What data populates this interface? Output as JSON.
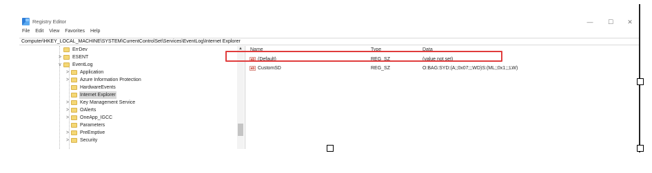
{
  "window": {
    "title": "Registry Editor",
    "controls": {
      "minimize": "—",
      "maximize": "☐",
      "close": "✕"
    }
  },
  "menu": [
    "File",
    "Edit",
    "View",
    "Favorites",
    "Help"
  ],
  "address": "Computer\\HKEY_LOCAL_MACHINE\\SYSTEM\\CurrentControlSet\\Services\\EventLog\\Internet Explorer",
  "tree": [
    {
      "label": "ErrDev",
      "expander": ""
    },
    {
      "label": "ESENT",
      "expander": ">"
    },
    {
      "label": "EventLog",
      "expander": "v"
    },
    {
      "label": "Application",
      "expander": ">"
    },
    {
      "label": "Azure Information Protection",
      "expander": ">"
    },
    {
      "label": "HardwareEvents",
      "expander": ""
    },
    {
      "label": "Internet Explorer",
      "expander": "",
      "selected": true
    },
    {
      "label": "Key Management Service",
      "expander": ">"
    },
    {
      "label": "OAlerts",
      "expander": ">"
    },
    {
      "label": "OneApp_IGCC",
      "expander": ">"
    },
    {
      "label": "Parameters",
      "expander": ""
    },
    {
      "label": "PreEmptive",
      "expander": ">"
    },
    {
      "label": "Security",
      "expander": ">"
    }
  ],
  "columns": {
    "name": "Name",
    "type": "Type",
    "data": "Data"
  },
  "values": [
    {
      "icon": "ab",
      "name": "(Default)",
      "type": "REG_SZ",
      "data": "(value not set)"
    },
    {
      "icon": "ab",
      "name": "CustomSD",
      "type": "REG_SZ",
      "data": "O:BAG:SYD:(A;;0x07;;;WD)S:(ML;;0x1;;;LW)",
      "highlighted": true
    }
  ],
  "colors": {
    "highlight": "#e03c3c",
    "folder": "#f4d775",
    "selection": "#d9d9d9"
  }
}
